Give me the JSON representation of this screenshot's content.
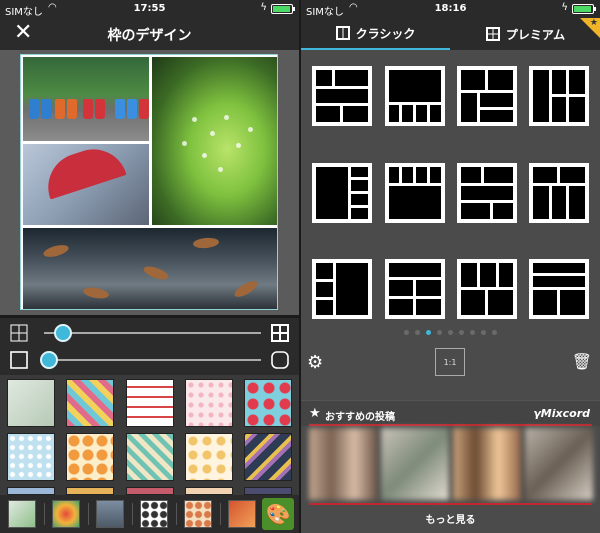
{
  "left": {
    "status": {
      "carrier": "SIMなし",
      "time": "17:55"
    },
    "title": "枠のデザイン",
    "icons": {
      "close": "close-icon",
      "grid_small": "grid-icon",
      "grid_large": "grid-icon",
      "square": "square-icon",
      "rounded": "rounded-square-icon",
      "palette": "palette-icon"
    },
    "sliders": {
      "spacing": 0.12,
      "corner": 0.03
    }
  },
  "right": {
    "status": {
      "carrier": "SIMなし",
      "time": "18:16"
    },
    "tabs": [
      {
        "label": "クラシック",
        "icon": "layout-icon"
      },
      {
        "label": "プレミアム",
        "icon": "grid-icon"
      }
    ],
    "premium_badge": "★",
    "page_indicator": {
      "count": 9,
      "active": 2
    },
    "settings_icon": "gear-icon",
    "ratio_label": "1:1",
    "trash_icon": "trash-icon",
    "featured": {
      "star": "★",
      "label": "おすすめの投稿",
      "brand": "γMixcord"
    },
    "more_label": "もっと見る"
  },
  "colors": {
    "accent": "#3fb8d9",
    "red": "#c3272f",
    "premium": "#f0b428"
  }
}
